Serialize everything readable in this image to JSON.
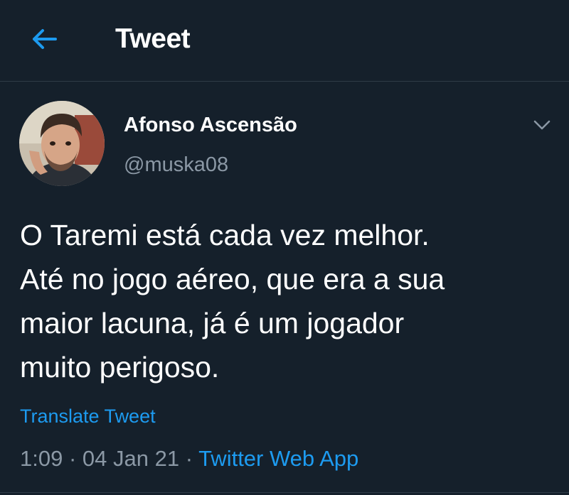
{
  "header": {
    "title": "Tweet",
    "back_icon": "arrow-left-icon"
  },
  "author": {
    "display_name": "Afonso Ascensão",
    "handle": "@muska08",
    "avatar_icon": "user-avatar-photo"
  },
  "menu_icon": "chevron-down-icon",
  "tweet": {
    "text": "O Taremi está cada vez melhor.\nAté no jogo aéreo, que era a sua\nmaior lacuna, já é um jogador\nmuito perigoso.",
    "translate_label": "Translate Tweet",
    "time": "1:09",
    "separator1": " · ",
    "date": "04 Jan 21",
    "separator2": " · ",
    "source": "Twitter Web App"
  },
  "colors": {
    "background": "#15202b",
    "accent": "#1d9bf0",
    "secondary_text": "#8b98a5",
    "divider": "#2f3b47"
  }
}
